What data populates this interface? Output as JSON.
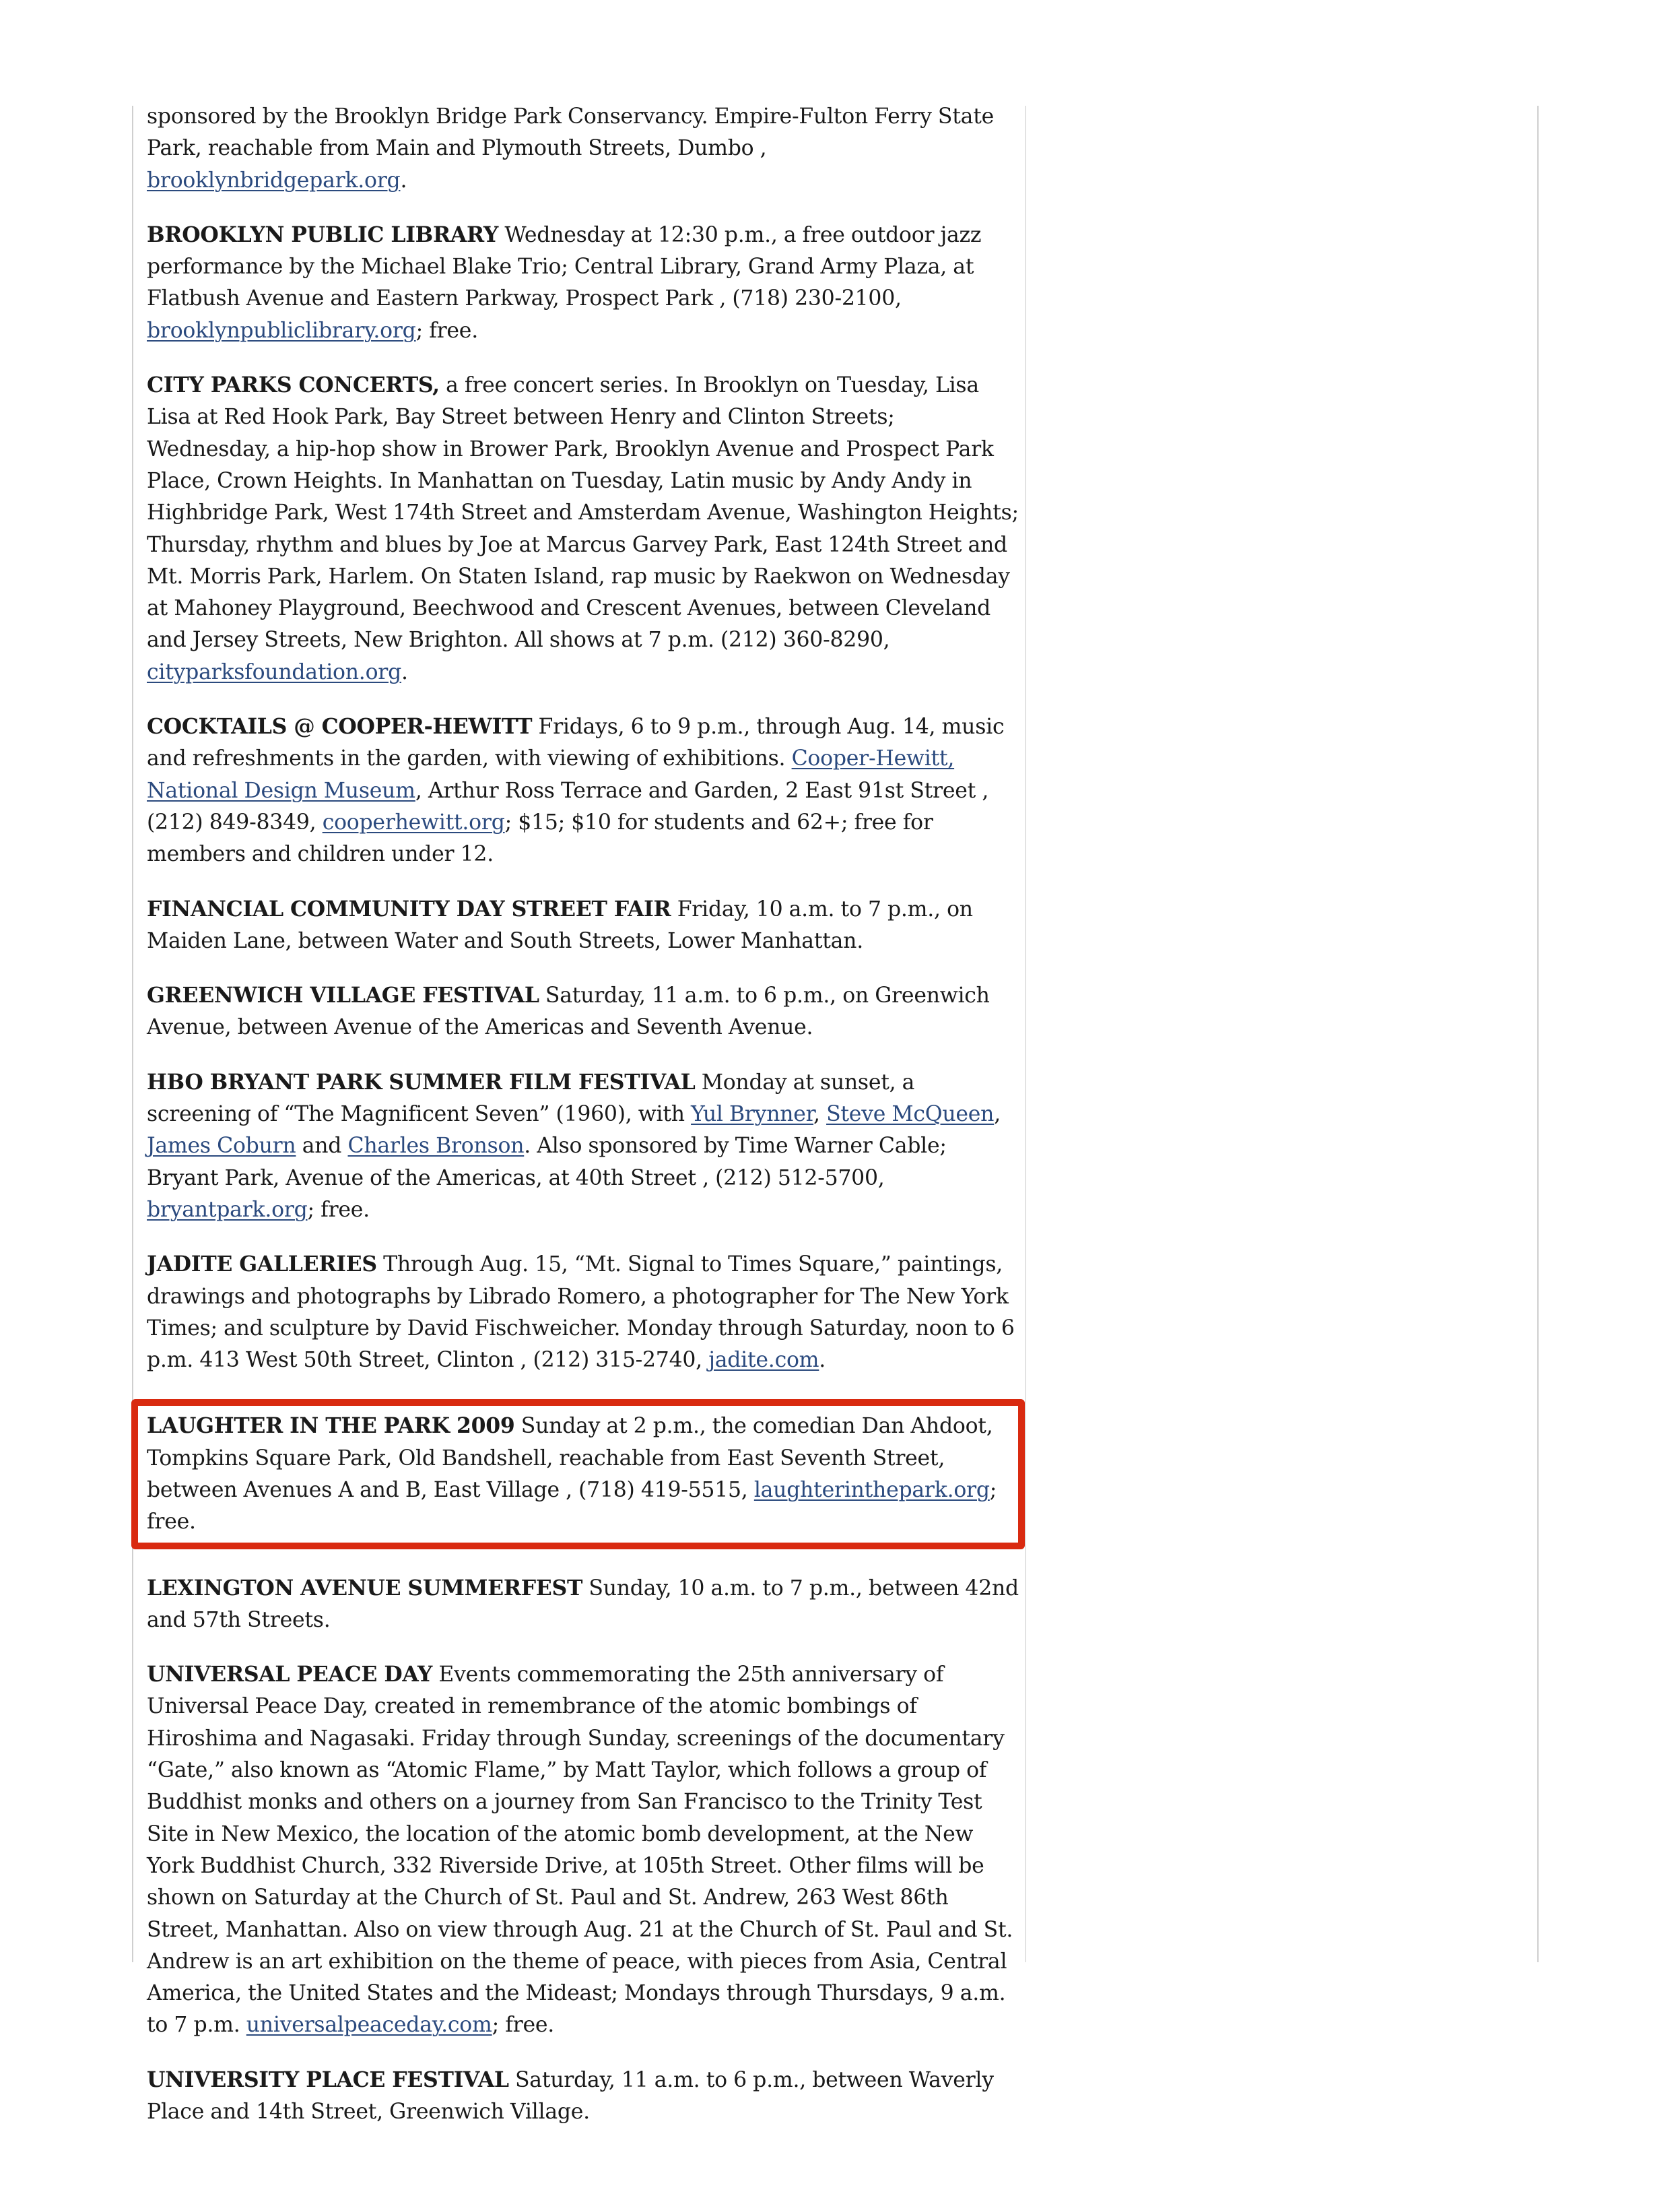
{
  "entries": [
    {
      "segs": [
        {
          "t": "sponsored by the Brooklyn Bridge Park Conservancy. Empire-Fulton Ferry State Park, reachable from Main and Plymouth Streets, Dumbo , "
        },
        {
          "t": "brooklynbridgepark.org",
          "link": true
        },
        {
          "t": "."
        }
      ]
    },
    {
      "segs": [
        {
          "t": "BROOKLYN PUBLIC LIBRARY",
          "b": true
        },
        {
          "t": " Wednesday at 12:30 p.m., a free outdoor jazz performance by the Michael Blake Trio; Central Library, Grand Army Plaza, at Flatbush Avenue and Eastern Parkway, Prospect Park , (718) 230-2100, "
        },
        {
          "t": "brooklynpubliclibrary.org",
          "link": true
        },
        {
          "t": "; free."
        }
      ]
    },
    {
      "segs": [
        {
          "t": "CITY PARKS CONCERTS,",
          "b": true
        },
        {
          "t": " a free concert series. In Brooklyn on Tuesday, Lisa Lisa at Red Hook Park, Bay Street between Henry and Clinton Streets; Wednesday, a hip-hop show in Brower Park, Brooklyn Avenue and Prospect Park Place, Crown Heights. In Manhattan on Tuesday, Latin music by Andy Andy in Highbridge Park, West 174th Street and Amsterdam Avenue, Washington Heights; Thursday, rhythm and blues by Joe at Marcus Garvey Park, East 124th Street and Mt. Morris Park, Harlem. On Staten Island, rap music by Raekwon on Wednesday at Mahoney Playground, Beechwood and Crescent Avenues, between Cleveland and Jersey Streets, New Brighton. All shows at 7 p.m. (212) 360-8290, "
        },
        {
          "t": "cityparksfoundation.org",
          "link": true
        },
        {
          "t": "."
        }
      ]
    },
    {
      "segs": [
        {
          "t": "COCKTAILS @ COOPER-HEWITT",
          "b": true
        },
        {
          "t": " Fridays, 6 to 9 p.m., through Aug. 14, music and refreshments in the garden, with viewing of exhibitions. "
        },
        {
          "t": "Cooper-Hewitt, National Design Museum",
          "link": true
        },
        {
          "t": ", Arthur Ross Terrace and Garden, 2 East 91st Street , (212) 849-8349, "
        },
        {
          "t": "cooperhewitt.org",
          "link": true
        },
        {
          "t": "; $15; $10 for students and 62+; free for members and children under 12."
        }
      ]
    },
    {
      "segs": [
        {
          "t": "FINANCIAL COMMUNITY DAY STREET FAIR",
          "b": true
        },
        {
          "t": " Friday, 10 a.m. to 7 p.m., on Maiden Lane, between Water and South Streets, Lower Manhattan."
        }
      ]
    },
    {
      "segs": [
        {
          "t": "GREENWICH VILLAGE FESTIVAL",
          "b": true
        },
        {
          "t": " Saturday, 11 a.m. to 6 p.m., on Greenwich Avenue, between Avenue of the Americas and Seventh Avenue."
        }
      ]
    },
    {
      "segs": [
        {
          "t": "HBO BRYANT PARK SUMMER FILM FESTIVAL",
          "b": true
        },
        {
          "t": " Monday at sunset, a screening of “The Magnificent Seven” (1960), with "
        },
        {
          "t": "Yul Brynner",
          "link": true
        },
        {
          "t": ", "
        },
        {
          "t": "Steve McQueen",
          "link": true
        },
        {
          "t": ", "
        },
        {
          "t": "James Coburn",
          "link": true
        },
        {
          "t": " and "
        },
        {
          "t": "Charles Bronson",
          "link": true
        },
        {
          "t": ". Also sponsored by Time Warner Cable; Bryant Park, Avenue of the Americas, at 40th Street , (212) 512-5700, "
        },
        {
          "t": "bryantpark.org",
          "link": true
        },
        {
          "t": "; free."
        }
      ]
    },
    {
      "segs": [
        {
          "t": "JADITE GALLERIES",
          "b": true
        },
        {
          "t": " Through Aug. 15, “Mt. Signal to Times Square,” paintings, drawings and photographs by Librado Romero, a photographer for The New York Times; and sculpture by David Fischweicher. Monday through Saturday, noon to 6 p.m. 413 West 50th Street, Clinton , (212) 315-2740, "
        },
        {
          "t": "jadite.com",
          "link": true
        },
        {
          "t": "."
        }
      ]
    },
    {
      "highlight": true,
      "segs": [
        {
          "t": "LAUGHTER IN THE PARK 2009",
          "b": true
        },
        {
          "t": " Sunday at 2 p.m., the comedian Dan Ahdoot, Tompkins Square Park, Old Bandshell, reachable from East Seventh Street, between Avenues A and B, East Village , (718) 419-5515, "
        },
        {
          "t": "laughterinthepark.org",
          "link": true
        },
        {
          "t": "; free."
        }
      ]
    },
    {
      "segs": [
        {
          "t": "LEXINGTON AVENUE SUMMERFEST",
          "b": true
        },
        {
          "t": " Sunday, 10 a.m. to 7 p.m., between 42nd and 57th Streets."
        }
      ]
    },
    {
      "segs": [
        {
          "t": "UNIVERSAL PEACE DAY",
          "b": true
        },
        {
          "t": " Events commemorating the 25th anniversary of Universal Peace Day, created in remembrance of the atomic bombings of Hiroshima and Nagasaki. Friday through Sunday, screenings of the documentary “Gate,” also known as “Atomic Flame,” by Matt Taylor, which follows a group of Buddhist monks and others on a journey from San Francisco to the Trinity Test Site in New Mexico, the location of the atomic bomb development, at the New York Buddhist Church, 332 Riverside Drive, at 105th Street. Other films will be shown on Saturday at the Church of St. Paul and St. Andrew, 263 West 86th Street, Manhattan. Also on view through Aug. 21 at the Church of St. Paul and St. Andrew is an art exhibition on the theme of peace, with pieces from Asia, Central America, the United States and the Mideast; Mondays through Thursdays, 9 a.m. to 7 p.m. "
        },
        {
          "t": "universalpeaceday.com",
          "link": true
        },
        {
          "t": "; free."
        }
      ]
    },
    {
      "segs": [
        {
          "t": "UNIVERSITY PLACE FESTIVAL",
          "b": true
        },
        {
          "t": " Saturday, 11 a.m. to 6 p.m., between Waverly Place and 14th Street, Greenwich Village."
        }
      ]
    }
  ],
  "colors": {
    "link": "#2b4a7e",
    "highlight_border": "#d92a10",
    "text": "#1a1a1a"
  }
}
